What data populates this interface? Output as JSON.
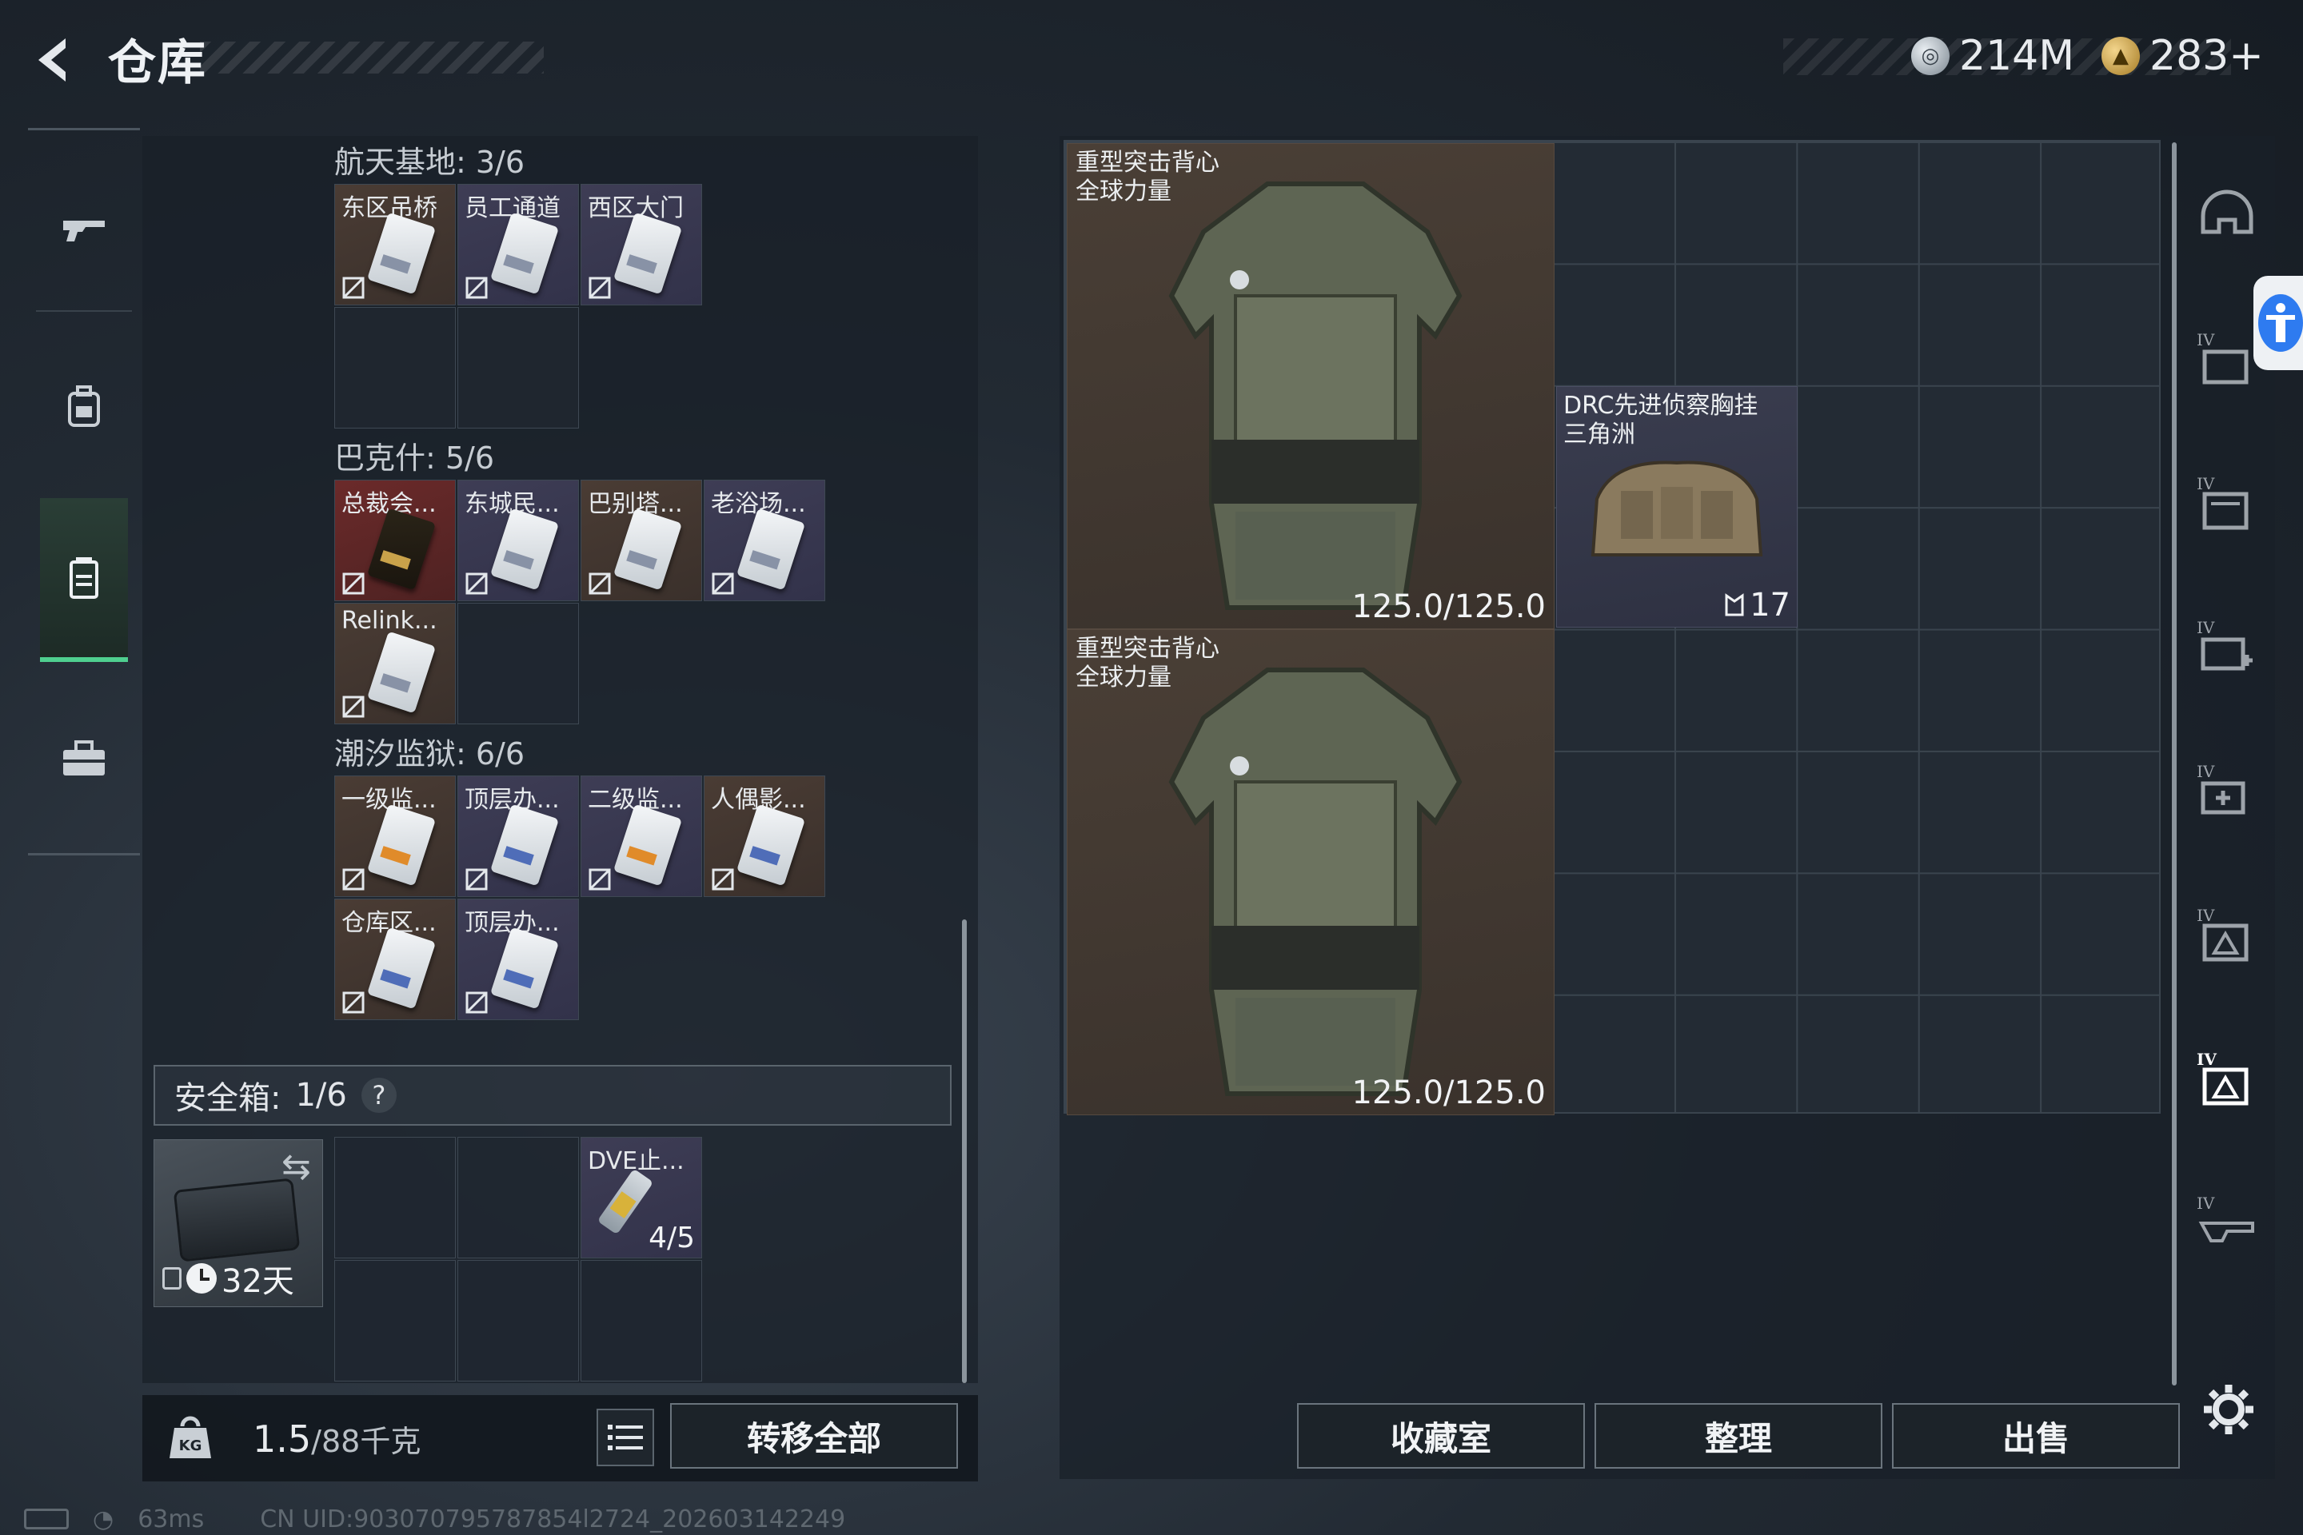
{
  "header": {
    "title": "仓库",
    "currencies": [
      {
        "icon": "silver-coin-icon",
        "value": "214M"
      },
      {
        "icon": "gold-coin-icon",
        "value": "283+"
      }
    ]
  },
  "nav": [
    {
      "icon": "gun-icon",
      "active": false
    },
    {
      "icon": "backpack-icon",
      "active": false
    },
    {
      "icon": "storage-icon",
      "active": true
    },
    {
      "icon": "toolbox-icon",
      "active": false
    }
  ],
  "sections": [
    {
      "label": "航天基地: 3/6",
      "items": [
        {
          "name": "东区吊桥",
          "tone": "brown",
          "card": "white"
        },
        {
          "name": "员工通道",
          "tone": "violet",
          "card": "white"
        },
        {
          "name": "西区大门",
          "tone": "violet",
          "card": "white"
        }
      ]
    },
    {
      "label": "巴克什: 5/6",
      "items": [
        {
          "name": "总裁会...",
          "tone": "red",
          "card": "gold"
        },
        {
          "name": "东城民...",
          "tone": "violet",
          "card": "white"
        },
        {
          "name": "巴别塔...",
          "tone": "brown",
          "card": "white"
        },
        {
          "name": "老浴场...",
          "tone": "violet",
          "card": "white"
        },
        {
          "name": "Relink...",
          "tone": "brown",
          "card": "white"
        }
      ]
    },
    {
      "label": "潮汐监狱: 6/6",
      "items": [
        {
          "name": "一级监...",
          "tone": "brown",
          "card": "orange"
        },
        {
          "name": "顶层办...",
          "tone": "violet",
          "card": "blue"
        },
        {
          "name": "二级监...",
          "tone": "violet",
          "card": "orange"
        },
        {
          "name": "人偶影...",
          "tone": "brown",
          "card": "blue"
        },
        {
          "name": "仓库区...",
          "tone": "brown",
          "card": "blue"
        },
        {
          "name": "顶层办...",
          "tone": "violet",
          "card": "blue"
        }
      ]
    }
  ],
  "safebox": {
    "label": "安全箱:",
    "count": "1/6",
    "help": "?",
    "days": "32天",
    "item": {
      "name": "DVE止...",
      "count": "4/5"
    }
  },
  "footer_left": {
    "weight": "1.5",
    "capacity": "/88千克",
    "transfer_all": "转移全部"
  },
  "stash": {
    "vests": [
      {
        "name": "重型突击背心",
        "subtitle": "全球力量",
        "durability": "125.0/125.0"
      },
      {
        "name": "重型突击背心",
        "subtitle": "全球力量",
        "durability": "125.0/125.0"
      }
    ],
    "rig": {
      "name": "DRC先进侦察胸挂",
      "subtitle": "三角洲",
      "count": "17"
    }
  },
  "side_icons": [
    "helmet-icon",
    "armor-tier-icon",
    "rig-tier-icon",
    "medkit-tier-icon",
    "medkit-tier-icon-2",
    "key-tier-icon",
    "key-tier-icon-active",
    "weapon-tier-icon"
  ],
  "footer_right": {
    "collection": "收藏室",
    "organize": "整理",
    "sell": "出售"
  },
  "status": {
    "ping": "63ms",
    "uid": "CN UID:903070795787854l2724_202603142249"
  }
}
